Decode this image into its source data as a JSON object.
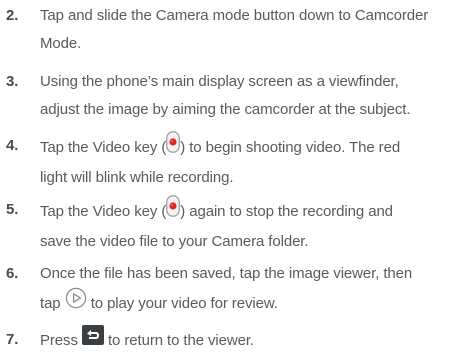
{
  "steps": [
    {
      "number": "2.",
      "lines": [
        {
          "text": "Tap and slide the Camera mode button down to Camcorder"
        },
        {
          "text": "Mode."
        }
      ]
    },
    {
      "number": "3.",
      "lines": [
        {
          "text": "Using the phone’s main display screen as a viewfinder,"
        },
        {
          "text": "adjust the image by aiming the camcorder at the subject."
        }
      ]
    },
    {
      "number": "4.",
      "lines": [
        {
          "before": "Tap the Video key (",
          "icon": "video-record-icon",
          "after": ") to begin shooting video. The red"
        },
        {
          "text": "light will blink while recording."
        }
      ]
    },
    {
      "number": "5.",
      "lines": [
        {
          "before": "Tap the Video key (",
          "icon": "video-record-icon",
          "after": ") again to stop the recording and"
        },
        {
          "text": "save the video file to your Camera folder."
        }
      ]
    },
    {
      "number": "6.",
      "lines": [
        {
          "text": "Once the file has been saved, tap the image viewer, then"
        },
        {
          "before": "tap ",
          "icon": "play-icon",
          "after": " to play your video for review."
        }
      ]
    },
    {
      "number": "7.",
      "lines": [
        {
          "before": "Press ",
          "icon": "back-icon",
          "after": " to return to the viewer."
        }
      ]
    }
  ],
  "colors": {
    "text": "#5a5a5a",
    "number": "#4a4a4a",
    "record_red": "#e0271f",
    "back_key_bg": "#3a3f44"
  }
}
